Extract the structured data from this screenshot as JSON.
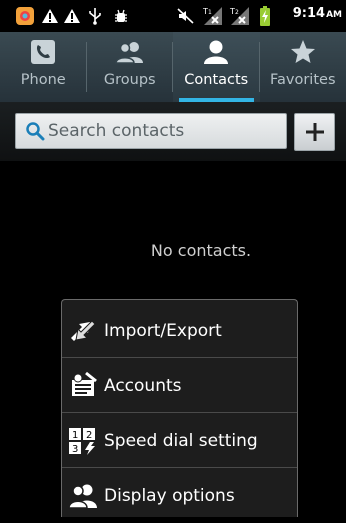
{
  "status_bar": {
    "time": "9:14",
    "ampm": "AM",
    "icons": [
      "app-icon",
      "warning-icon",
      "warning-icon",
      "usb-icon",
      "debug-icon",
      "mute-icon",
      "signal-1-icon",
      "signal-2-icon",
      "battery-charging-icon"
    ],
    "sim1": "1",
    "sim2": "2"
  },
  "tabs": [
    {
      "label": "Phone",
      "icon": "phone-icon"
    },
    {
      "label": "Groups",
      "icon": "groups-icon"
    },
    {
      "label": "Contacts",
      "icon": "contact-icon",
      "active": true
    },
    {
      "label": "Favorites",
      "icon": "star-icon"
    }
  ],
  "search": {
    "placeholder": "Search contacts"
  },
  "empty_message": "No contacts.",
  "menu": {
    "items": [
      {
        "label": "Import/Export",
        "icon": "import-export-icon"
      },
      {
        "label": "Accounts",
        "icon": "accounts-icon"
      },
      {
        "label": "Speed dial setting",
        "icon": "speed-dial-icon"
      },
      {
        "label": "Display options",
        "icon": "display-options-icon"
      }
    ]
  },
  "speed_dial_icon_digits": [
    "1",
    "2",
    "3"
  ],
  "colors": {
    "accent": "#33b5e5",
    "tab_bg": "#2f3d44"
  }
}
